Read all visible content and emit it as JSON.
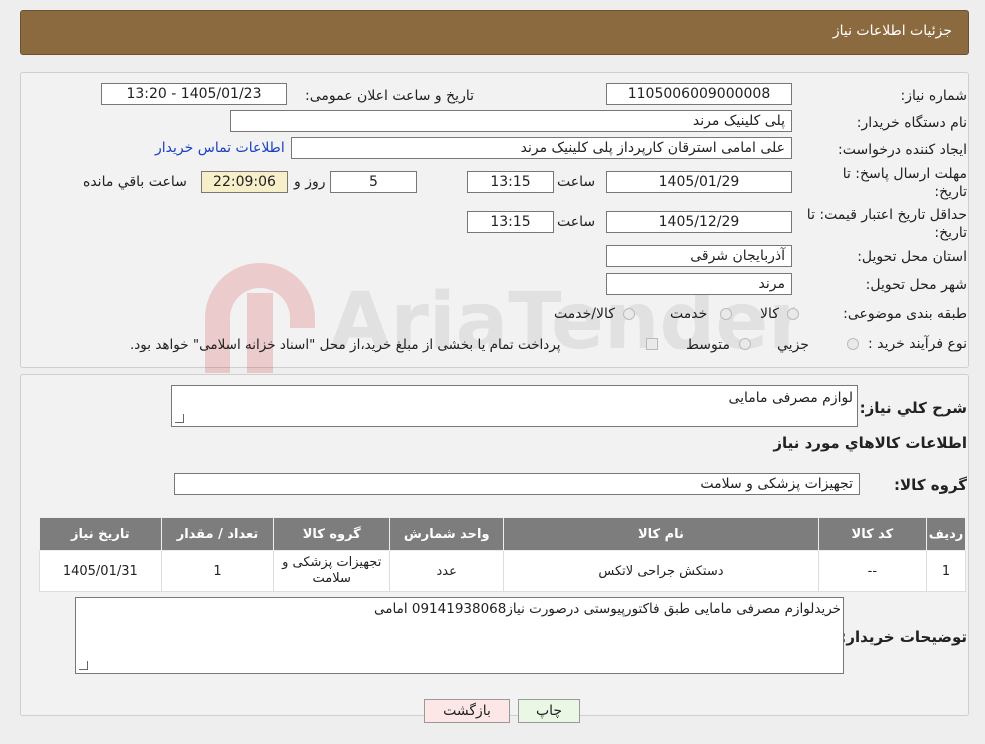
{
  "header": {
    "title": "جزئیات اطلاعات نیاز"
  },
  "watermark": {
    "text": "AriaTender.neT"
  },
  "form": {
    "need_number_label": "شماره نیاز:",
    "need_number": "1105006009000008",
    "announce_label": "تاریخ و ساعت اعلان عمومی:",
    "announce_value": "1405/01/23 - 13:20",
    "buyer_org_label": "نام دستگاه خریدار:",
    "buyer_org": "پلی کلینیک مرند",
    "creator_label": "ایجاد کننده درخواست:",
    "creator": "علی امامی استرقان کارپرداز پلی کلینیک مرند",
    "contact_link": "اطلاعات تماس خریدار",
    "reply_deadline_label_1": "مهلت ارسال پاسخ: تا",
    "reply_deadline_label_2": "تاریخ:",
    "reply_date": "1405/01/29",
    "time_label": "ساعت",
    "reply_time": "13:15",
    "days_value": "5",
    "days_label": "روز و",
    "remaining_time": "22:09:06",
    "remaining_label": "ساعت باقي مانده",
    "validity_label_1": "حداقل تاریخ اعتبار قیمت: تا",
    "validity_label_2": "تاریخ:",
    "validity_date": "1405/12/29",
    "validity_time": "13:15",
    "province_label": "استان محل تحویل:",
    "province": "آذربایجان شرقی",
    "city_label": "شهر محل تحویل:",
    "city": "مرند",
    "category_label": "طبقه بندی موضوعی:",
    "category_options": [
      "کالا",
      "خدمت",
      "کالا/خدمت"
    ],
    "process_label": "نوع فرآیند خرید :",
    "process_options": [
      "جزیي",
      "متوسط"
    ],
    "process_note": "پرداخت تمام یا بخشی از مبلغ خرید،از محل \"اسناد خزانه اسلامی\" خواهد بود."
  },
  "need": {
    "summary_label": "شرح کلي نياز:",
    "summary": "لوازم مصرفی مامایی",
    "goods_info_title": "اطلاعات کالاهاي مورد نياز",
    "goods_group_label": "گروه کالا:",
    "goods_group": "تجهیزات پزشکی و سلامت"
  },
  "table": {
    "headers": [
      "رديف",
      "کد کالا",
      "نام کالا",
      "واحد شمارش",
      "گروه کالا",
      "تعداد / مقدار",
      "تاريخ نياز"
    ],
    "rows": [
      [
        "1",
        "--",
        "دستکش جراحی لاتکس",
        "عدد",
        "تجهیزات پزشکی و سلامت",
        "1",
        "1405/01/31"
      ]
    ]
  },
  "buyer_notes": {
    "label": "توضیحات خریدار:",
    "text": "خریدلوازم مصرفی مامایی طبق فاکتورپیوستی درصورت نیاز09141938068 امامی"
  },
  "buttons": {
    "print": "چاپ",
    "back": "بازگشت"
  },
  "colors": {
    "header": "#8c6a3f",
    "back_button": "#fde6e6",
    "print_button": "#e9f7e4",
    "remaining": "#f7efc9"
  }
}
